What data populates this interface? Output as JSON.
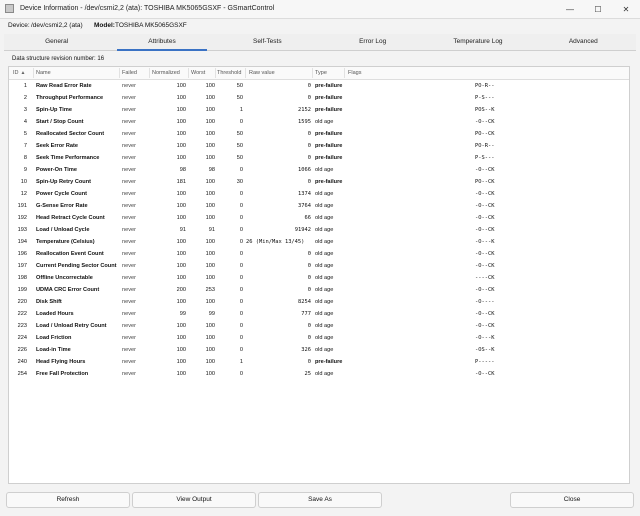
{
  "window": {
    "title": "Device Information - /dev/csmi2,2 (ata): TOSHIBA MK5065GSXF - GSmartControl",
    "minimize": "—",
    "maximize": "☐",
    "close": "✕"
  },
  "device_info": {
    "device_label": "Device:",
    "device_value": "/dev/csmi2,2 (ata)",
    "model_label": "Model:",
    "model_value": "TOSHIBA MK5065GSXF"
  },
  "tabs": [
    {
      "label": "General"
    },
    {
      "label": "Attributes"
    },
    {
      "label": "Self-Tests"
    },
    {
      "label": "Error Log"
    },
    {
      "label": "Temperature Log"
    },
    {
      "label": "Advanced"
    }
  ],
  "active_tab": "Attributes",
  "revision_text": "Data structure revision number: 16",
  "table": {
    "columns": [
      "ID",
      "Name",
      "Failed",
      "Normalized",
      "Worst",
      "Threshold",
      "Raw value",
      "Type",
      "Flags"
    ],
    "sort_indicator": "▲",
    "rows": [
      {
        "id": "1",
        "name": "Raw Read Error Rate",
        "failed": "never",
        "norm": "100",
        "worst": "100",
        "thr": "50",
        "raw": "0",
        "type": "pre-failure",
        "flags": "PO-R--"
      },
      {
        "id": "2",
        "name": "Throughput Performance",
        "failed": "never",
        "norm": "100",
        "worst": "100",
        "thr": "50",
        "raw": "0",
        "type": "pre-failure",
        "flags": "P-S---"
      },
      {
        "id": "3",
        "name": "Spin-Up Time",
        "failed": "never",
        "norm": "100",
        "worst": "100",
        "thr": "1",
        "raw": "2152",
        "type": "pre-failure",
        "flags": "POS--K"
      },
      {
        "id": "4",
        "name": "Start / Stop Count",
        "failed": "never",
        "norm": "100",
        "worst": "100",
        "thr": "0",
        "raw": "1595",
        "type": "old age",
        "flags": "-O--CK"
      },
      {
        "id": "5",
        "name": "Reallocated Sector Count",
        "failed": "never",
        "norm": "100",
        "worst": "100",
        "thr": "50",
        "raw": "0",
        "type": "pre-failure",
        "flags": "PO--CK"
      },
      {
        "id": "7",
        "name": "Seek Error Rate",
        "failed": "never",
        "norm": "100",
        "worst": "100",
        "thr": "50",
        "raw": "0",
        "type": "pre-failure",
        "flags": "PO-R--"
      },
      {
        "id": "8",
        "name": "Seek Time Performance",
        "failed": "never",
        "norm": "100",
        "worst": "100",
        "thr": "50",
        "raw": "0",
        "type": "pre-failure",
        "flags": "P-S---"
      },
      {
        "id": "9",
        "name": "Power-On Time",
        "failed": "never",
        "norm": "98",
        "worst": "98",
        "thr": "0",
        "raw": "1066",
        "type": "old age",
        "flags": "-O--CK"
      },
      {
        "id": "10",
        "name": "Spin-Up Retry Count",
        "failed": "never",
        "norm": "181",
        "worst": "100",
        "thr": "30",
        "raw": "0",
        "type": "pre-failure",
        "flags": "PO--CK"
      },
      {
        "id": "12",
        "name": "Power Cycle Count",
        "failed": "never",
        "norm": "100",
        "worst": "100",
        "thr": "0",
        "raw": "1374",
        "type": "old age",
        "flags": "-O--CK"
      },
      {
        "id": "191",
        "name": "G-Sense Error Rate",
        "failed": "never",
        "norm": "100",
        "worst": "100",
        "thr": "0",
        "raw": "3764",
        "type": "old age",
        "flags": "-O--CK"
      },
      {
        "id": "192",
        "name": "Head Retract Cycle Count",
        "failed": "never",
        "norm": "100",
        "worst": "100",
        "thr": "0",
        "raw": "66",
        "type": "old age",
        "flags": "-O--CK"
      },
      {
        "id": "193",
        "name": "Load / Unload Cycle",
        "failed": "never",
        "norm": "91",
        "worst": "91",
        "thr": "0",
        "raw": "91942",
        "type": "old age",
        "flags": "-O--CK"
      },
      {
        "id": "194",
        "name": "Temperature (Celsius)",
        "failed": "never",
        "norm": "100",
        "worst": "100",
        "thr": "0",
        "raw": "26 (Min/Max 13/45)",
        "type": "old age",
        "flags": "-O---K"
      },
      {
        "id": "196",
        "name": "Reallocation Event Count",
        "failed": "never",
        "norm": "100",
        "worst": "100",
        "thr": "0",
        "raw": "0",
        "type": "old age",
        "flags": "-O--CK"
      },
      {
        "id": "197",
        "name": "Current Pending Sector Count",
        "failed": "never",
        "norm": "100",
        "worst": "100",
        "thr": "0",
        "raw": "0",
        "type": "old age",
        "flags": "-O--CK"
      },
      {
        "id": "198",
        "name": "Offline Uncorrectable",
        "failed": "never",
        "norm": "100",
        "worst": "100",
        "thr": "0",
        "raw": "0",
        "type": "old age",
        "flags": "----CK"
      },
      {
        "id": "199",
        "name": "UDMA CRC Error Count",
        "failed": "never",
        "norm": "200",
        "worst": "253",
        "thr": "0",
        "raw": "0",
        "type": "old age",
        "flags": "-O--CK"
      },
      {
        "id": "220",
        "name": "Disk Shift",
        "failed": "never",
        "norm": "100",
        "worst": "100",
        "thr": "0",
        "raw": "8254",
        "type": "old age",
        "flags": "-O----"
      },
      {
        "id": "222",
        "name": "Loaded Hours",
        "failed": "never",
        "norm": "99",
        "worst": "99",
        "thr": "0",
        "raw": "777",
        "type": "old age",
        "flags": "-O--CK"
      },
      {
        "id": "223",
        "name": "Load / Unload Retry Count",
        "failed": "never",
        "norm": "100",
        "worst": "100",
        "thr": "0",
        "raw": "0",
        "type": "old age",
        "flags": "-O--CK"
      },
      {
        "id": "224",
        "name": "Load Friction",
        "failed": "never",
        "norm": "100",
        "worst": "100",
        "thr": "0",
        "raw": "0",
        "type": "old age",
        "flags": "-O---K"
      },
      {
        "id": "226",
        "name": "Load-in Time",
        "failed": "never",
        "norm": "100",
        "worst": "100",
        "thr": "0",
        "raw": "326",
        "type": "old age",
        "flags": "-OS--K"
      },
      {
        "id": "240",
        "name": "Head Flying Hours",
        "failed": "never",
        "norm": "100",
        "worst": "100",
        "thr": "1",
        "raw": "0",
        "type": "pre-failure",
        "flags": "P-----"
      },
      {
        "id": "254",
        "name": "Free Fall Protection",
        "failed": "never",
        "norm": "100",
        "worst": "100",
        "thr": "0",
        "raw": "25",
        "type": "old age",
        "flags": "-O--CK"
      }
    ]
  },
  "buttons": {
    "refresh": "Refresh",
    "view_output": "View Output",
    "save_as": "Save As",
    "close": "Close"
  }
}
